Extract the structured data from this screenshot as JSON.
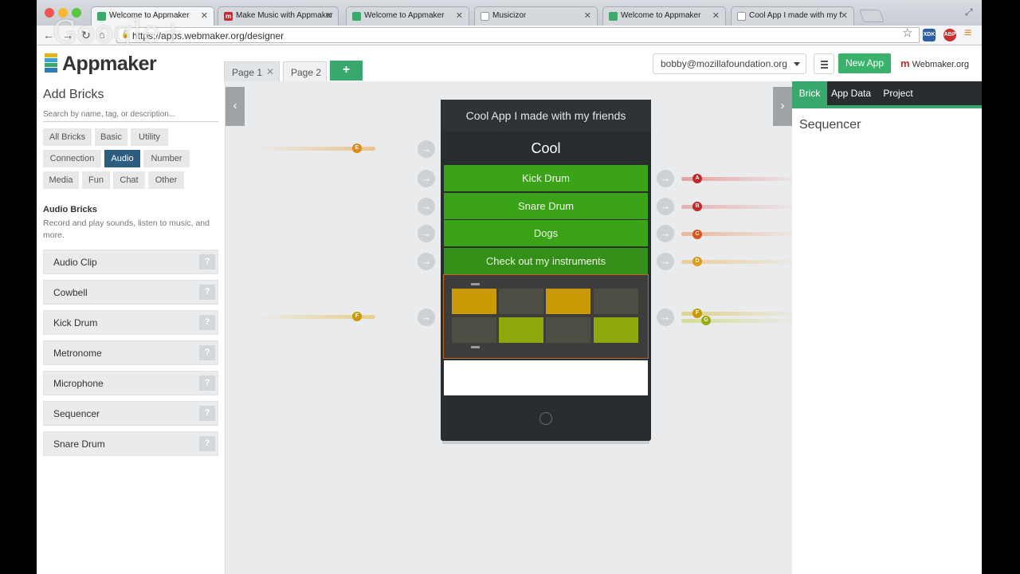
{
  "browser": {
    "tabs": [
      {
        "title": "Welcome to Appmaker",
        "favicon": "appmaker-icon",
        "active": true
      },
      {
        "title": "Make Music with Appmaker",
        "favicon": "webmaker-icon",
        "active": false
      },
      {
        "title": "Welcome to Appmaker",
        "favicon": "appmaker-icon",
        "active": false
      },
      {
        "title": "Musicizor",
        "favicon": "page-icon",
        "active": false
      },
      {
        "title": "Welcome to Appmaker",
        "favicon": "appmaker-icon",
        "active": false
      },
      {
        "title": "Cool App I made with my f",
        "favicon": "page-icon",
        "active": false
      }
    ],
    "url": "https://apps.webmaker.org/designer",
    "watermark": "Google+",
    "extensions": [
      "XDK",
      "ABP"
    ]
  },
  "header": {
    "logo": "Appmaker",
    "pages": [
      "Page 1",
      "Page 2"
    ],
    "add_page": "+",
    "account": "bobby@mozillafoundation.org",
    "new_app": "New App",
    "webmaker": "Webmaker.org"
  },
  "left_panel": {
    "title": "Add Bricks",
    "search_placeholder": "Search by name, tag, or description...",
    "categories": [
      "All Bricks",
      "Basic",
      "Utility",
      "Connection",
      "Audio",
      "Number",
      "Media",
      "Fun",
      "Chat",
      "Other"
    ],
    "selected_category": "Audio",
    "section_title": "Audio Bricks",
    "section_desc": "Record and play sounds, listen to music, and more.",
    "bricks": [
      "Audio Clip",
      "Cowbell",
      "Kick Drum",
      "Metronome",
      "Microphone",
      "Sequencer",
      "Snare Drum"
    ],
    "help": "?"
  },
  "phone": {
    "title": "Cool App I made with my friends",
    "heading": "Cool",
    "buttons": [
      "Kick Drum",
      "Snare Drum",
      "Dogs",
      "Check out my instruments"
    ],
    "sequencer_colors": {
      "active_a": "#c99a05",
      "active_b": "#8ea80c",
      "idle": "#4d4d44"
    }
  },
  "channels": {
    "left": [
      "E",
      "F"
    ],
    "right": [
      "A",
      "B",
      "C",
      "D",
      "F",
      "G"
    ],
    "colors": {
      "A": "#c22a2a",
      "B": "#c22a2a",
      "C": "#d9541a",
      "D": "#e09a1a",
      "E": "#e08a1a",
      "F": "#c99a05",
      "G": "#9aab12"
    }
  },
  "right_panel": {
    "tabs": [
      "Brick",
      "App Data",
      "Project"
    ],
    "selected_tab": "Brick",
    "brick_name": "Sequencer"
  },
  "colors": {
    "accent": "#39a86c",
    "selected_chip": "#2c5c80"
  }
}
